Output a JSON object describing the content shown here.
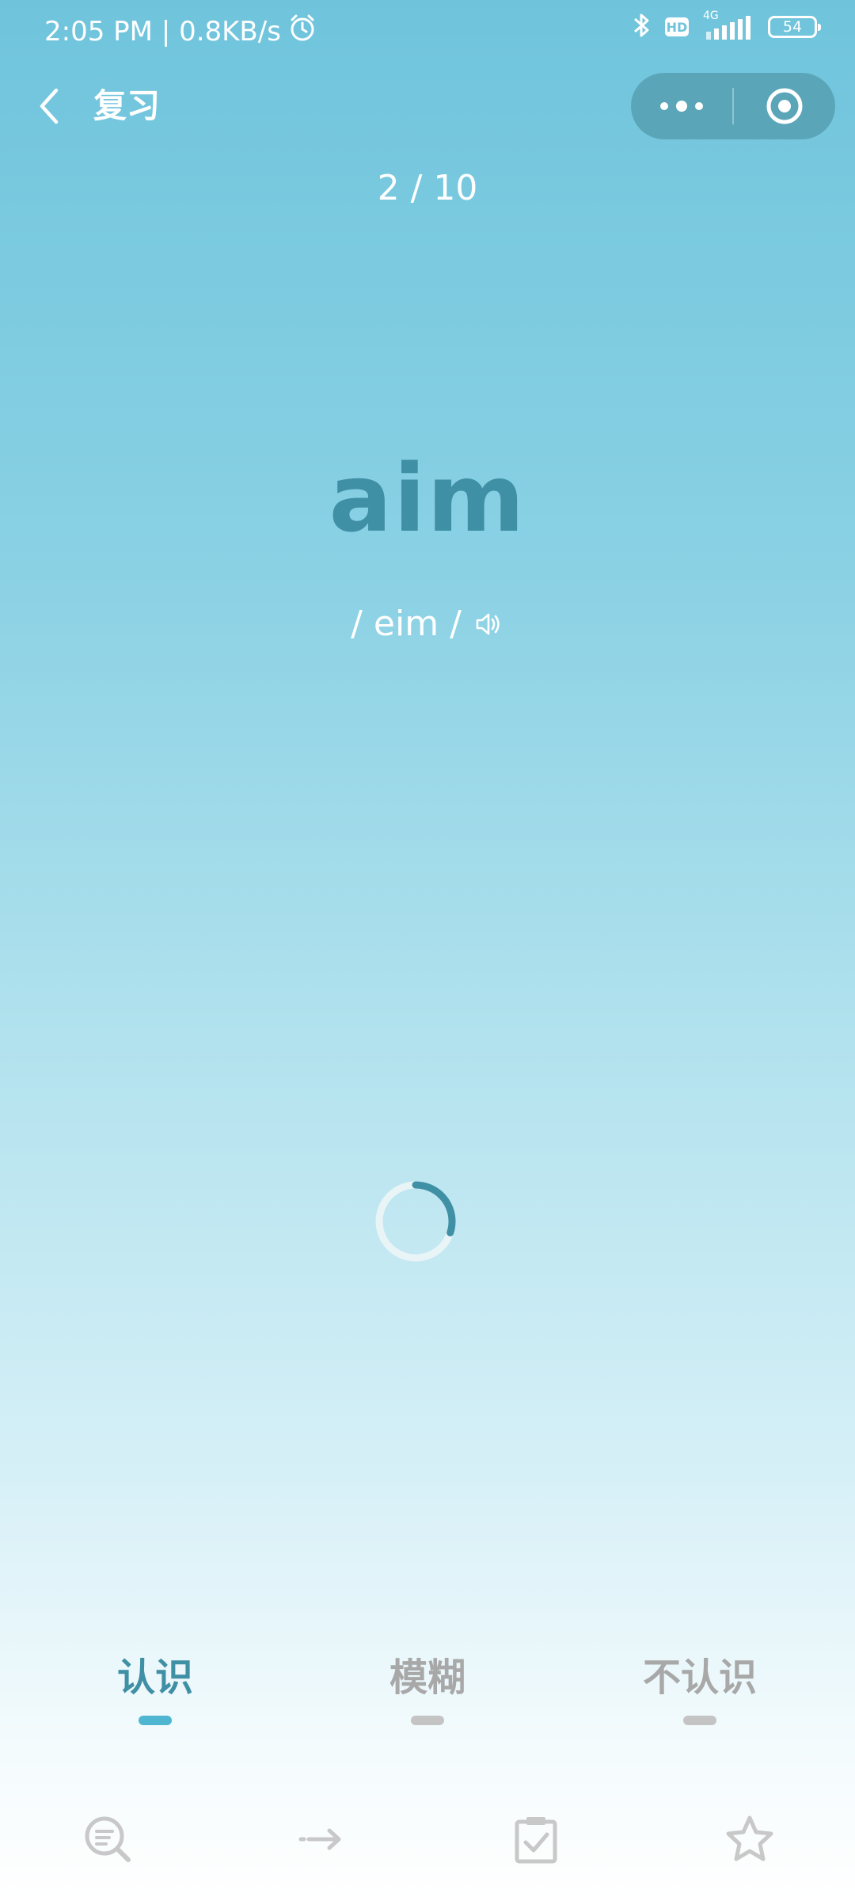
{
  "status_bar": {
    "time_speed": "2:05 PM | 0.8KB/s",
    "hd_badge": "HD",
    "network": "4G",
    "battery": "54"
  },
  "nav": {
    "title": "复习"
  },
  "progress": "2 / 10",
  "word": "aim",
  "phonetic": "/ eim /",
  "loading_progress": 0.3,
  "choices": [
    {
      "label": "认识",
      "active": true
    },
    {
      "label": "模糊",
      "active": false
    },
    {
      "label": "不认识",
      "active": false
    }
  ],
  "colors": {
    "accent": "#3f8fa5",
    "active_bar": "#4fb6d2",
    "inactive": "#a8a8a8",
    "inactive_bar": "#c4c4c4"
  },
  "toolbar": {
    "icons": [
      "search-list-icon",
      "arrow-right-icon",
      "clipboard-check-icon",
      "star-icon"
    ]
  }
}
